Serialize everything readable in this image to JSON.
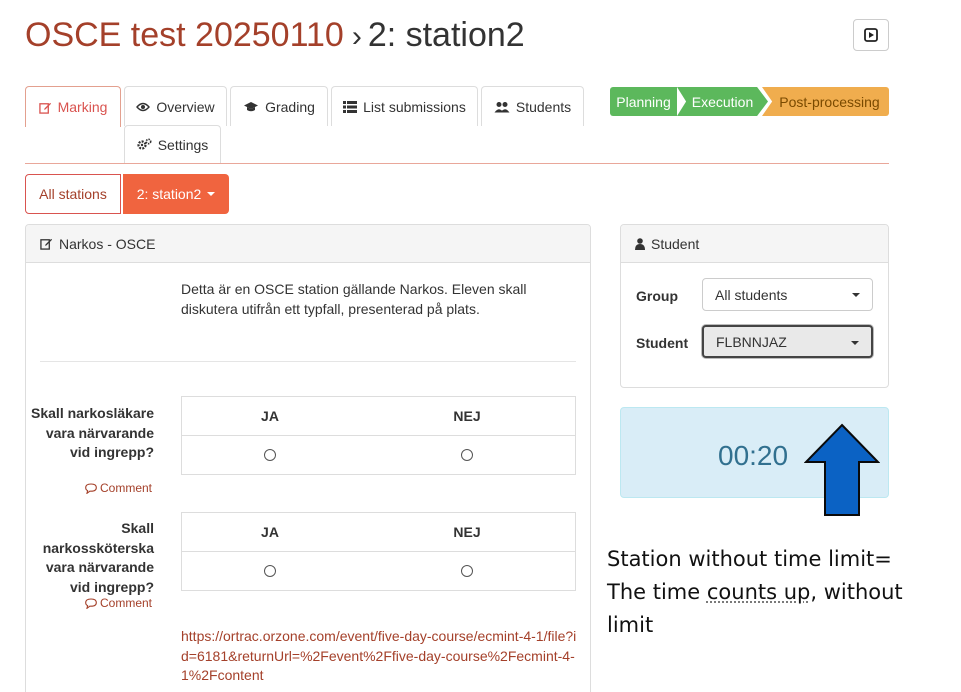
{
  "header": {
    "course_title": "OSCE test 20250110",
    "separator": "›",
    "station_title": "2: station2",
    "present_icon": "play-square-icon"
  },
  "tabs": [
    {
      "label": "Marking",
      "icon": "edit-icon",
      "active": true
    },
    {
      "label": "Overview",
      "icon": "eye-icon"
    },
    {
      "label": "Grading",
      "icon": "graduation-cap-icon"
    },
    {
      "label": "List submissions",
      "icon": "list-icon"
    },
    {
      "label": "Students",
      "icon": "users-icon"
    },
    {
      "label": "Settings",
      "icon": "cogs-icon"
    }
  ],
  "phases": {
    "planning": "Planning",
    "execution": "Execution",
    "post_processing": "Post-processing",
    "colors": {
      "done": "#5cb85c",
      "current": "#f0ad4e"
    }
  },
  "station_switch": {
    "all_label": "All stations",
    "current_label": "2: station2"
  },
  "marking_panel": {
    "heading": "Narkos - OSCE",
    "description": "Detta är en OSCE station gällande Narkos. Eleven skall diskutera utifrån ett typfall, presenterad på plats.",
    "questions": [
      {
        "text": "Skall narkosläkare vara närvarande vid ingrepp?",
        "comment": "Comment",
        "options": [
          "JA",
          "NEJ"
        ]
      },
      {
        "text": "Skall narkossköterska vara närvarande vid ingrepp?",
        "comment": "Comment",
        "options": [
          "JA",
          "NEJ"
        ]
      }
    ],
    "link": "https://ortrac.orzone.com/event/five-day-course/ecmint-4-1/file?id=6181&returnUrl=%2Fevent%2Ffive-day-course%2Fecmint-4-1%2Fcontent"
  },
  "student_panel": {
    "heading": "Student",
    "group_label": "Group",
    "group_value": "All students",
    "student_label": "Student",
    "student_value": "FLBNNJAZ"
  },
  "timer": {
    "value": "00:20"
  },
  "annotation": {
    "line1": "Station without time limit=",
    "line2a": "The time ",
    "line2b": "counts up",
    "line2c": ", without",
    "line3": "limit",
    "arrow_color": "#0b62c4"
  }
}
